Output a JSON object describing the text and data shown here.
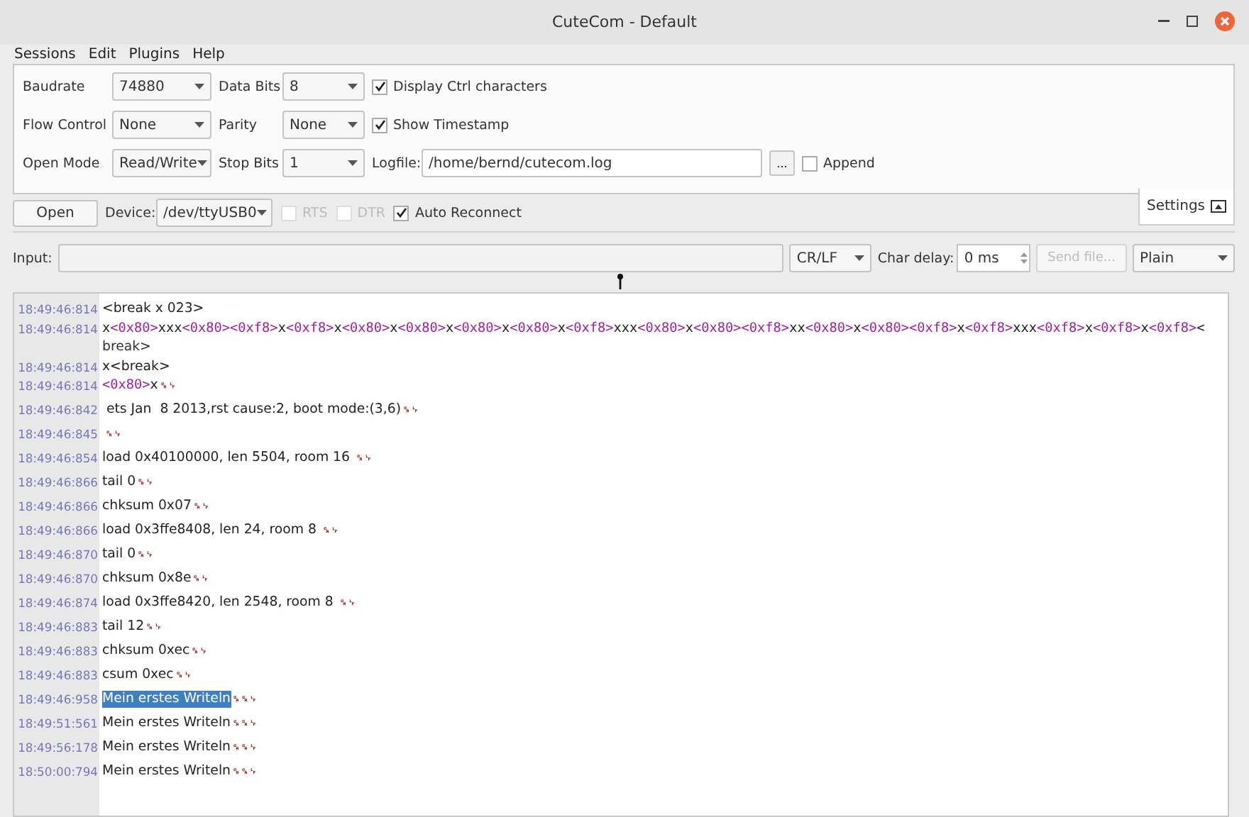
{
  "window": {
    "title": "CuteCom - Default"
  },
  "menu": [
    {
      "label": "Sessions"
    },
    {
      "label": "Edit"
    },
    {
      "label": "Plugins"
    },
    {
      "label": "Help"
    }
  ],
  "settings": {
    "rows": [
      {
        "label": "Baudrate",
        "combo_value": "74880",
        "label2": "Data Bits",
        "combo2_value": "8",
        "option": {
          "kind": "checkbox",
          "label": "Display Ctrl characters",
          "checked": true
        }
      },
      {
        "label": "Flow Control",
        "combo_value": "None",
        "label2": "Parity",
        "combo2_value": "None",
        "option": {
          "kind": "checkbox",
          "label": "Show Timestamp",
          "checked": true
        }
      },
      {
        "label": "Open Mode",
        "combo_value": "Read/Write",
        "label2": "Stop Bits",
        "combo2_value": "1",
        "option": {
          "kind": "logfile",
          "label": "Logfile:",
          "value": "/home/bernd/cutecom.log",
          "browse": "...",
          "append_label": "Append",
          "checked": false
        }
      }
    ],
    "tab_label": "Settings"
  },
  "device_bar": {
    "open_button": "Open",
    "device_label": "Device:",
    "device_value": "/dev/ttyUSB0",
    "checks": [
      {
        "label": "RTS",
        "checked": false,
        "disabled": true
      },
      {
        "label": "DTR",
        "checked": false,
        "disabled": true
      },
      {
        "label": "Auto Reconnect",
        "checked": true,
        "disabled": false
      }
    ]
  },
  "input_bar": {
    "label": "Input:",
    "line_end": "CR/LF",
    "char_delay_label": "Char delay:",
    "char_delay_value": "0 ms",
    "send_file": "Send file...",
    "send_file_disabled": true,
    "format": "Plain"
  },
  "log": [
    {
      "time": "18:49:46:814",
      "segments": [
        {
          "kind": "plain",
          "text": "<break x 023>"
        }
      ],
      "selected": false
    },
    {
      "time": "18:49:46:814",
      "segments": [
        {
          "kind": "plain",
          "text": "x"
        },
        {
          "kind": "hex",
          "text": "<0x80>"
        },
        {
          "kind": "plain",
          "text": "xxx"
        },
        {
          "kind": "hex",
          "text": "<0x80><0xf8>"
        },
        {
          "kind": "plain",
          "text": "x"
        },
        {
          "kind": "hex",
          "text": "<0xf8>"
        },
        {
          "kind": "plain",
          "text": "x"
        },
        {
          "kind": "hex",
          "text": "<0x80>"
        },
        {
          "kind": "plain",
          "text": "x"
        },
        {
          "kind": "hex",
          "text": "<0x80>"
        },
        {
          "kind": "plain",
          "text": "x"
        },
        {
          "kind": "hex",
          "text": "<0x80>"
        },
        {
          "kind": "plain",
          "text": "x"
        },
        {
          "kind": "hex",
          "text": "<0x80>"
        },
        {
          "kind": "plain",
          "text": "x"
        },
        {
          "kind": "hex",
          "text": "<0xf8>"
        },
        {
          "kind": "plain",
          "text": "xxx"
        },
        {
          "kind": "hex",
          "text": "<0x80>"
        },
        {
          "kind": "plain",
          "text": "x"
        },
        {
          "kind": "hex",
          "text": "<0x80><0xf8>"
        },
        {
          "kind": "plain",
          "text": "xx"
        },
        {
          "kind": "hex",
          "text": "<0x80>"
        },
        {
          "kind": "plain",
          "text": "x"
        },
        {
          "kind": "hex",
          "text": "<0x80><0xf8>"
        },
        {
          "kind": "plain",
          "text": "x"
        },
        {
          "kind": "hex",
          "text": "<0xf8>"
        },
        {
          "kind": "plain",
          "text": "xxx"
        },
        {
          "kind": "hex",
          "text": "<0xf8>"
        },
        {
          "kind": "plain",
          "text": "x"
        },
        {
          "kind": "hex",
          "text": "<0xf8>"
        },
        {
          "kind": "plain",
          "text": "x"
        },
        {
          "kind": "hex",
          "text": "<0xf8>"
        },
        {
          "kind": "plain",
          "text": "<"
        }
      ],
      "continuation": "break>",
      "selected": false
    },
    {
      "time": "18:49:46:814",
      "segments": [
        {
          "kind": "plain",
          "text": "x<break>"
        }
      ],
      "selected": false
    },
    {
      "time": "18:49:46:814",
      "segments": [
        {
          "kind": "hex",
          "text": "<0x80>"
        },
        {
          "kind": "plain",
          "text": "x"
        }
      ],
      "ctrl": "␍␊",
      "selected": false
    },
    {
      "time": "18:49:46:842",
      "segments": [
        {
          "kind": "plain",
          "text": " ets Jan  8 2013,rst cause:2, boot mode:(3,6)"
        }
      ],
      "ctrl": "␍␊",
      "selected": false
    },
    {
      "time": "18:49:46:845",
      "ctrl": "␍␊",
      "selected": false
    },
    {
      "time": "18:49:46:854",
      "segments": [
        {
          "kind": "plain",
          "text": "load 0x40100000, len 5504, room 16 "
        }
      ],
      "ctrl": "␍␊",
      "selected": false
    },
    {
      "time": "18:49:46:866",
      "segments": [
        {
          "kind": "plain",
          "text": "tail 0"
        }
      ],
      "ctrl": "␍␊",
      "selected": false
    },
    {
      "time": "18:49:46:866",
      "segments": [
        {
          "kind": "plain",
          "text": "chksum 0x07"
        }
      ],
      "ctrl": "␍␊",
      "selected": false
    },
    {
      "time": "18:49:46:866",
      "segments": [
        {
          "kind": "plain",
          "text": "load 0x3ffe8408, len 24, room 8 "
        }
      ],
      "ctrl": "␍␊",
      "selected": false
    },
    {
      "time": "18:49:46:870",
      "segments": [
        {
          "kind": "plain",
          "text": "tail 0"
        }
      ],
      "ctrl": "␍␊",
      "selected": false
    },
    {
      "time": "18:49:46:870",
      "segments": [
        {
          "kind": "plain",
          "text": "chksum 0x8e"
        }
      ],
      "ctrl": "␍␊",
      "selected": false
    },
    {
      "time": "18:49:46:874",
      "segments": [
        {
          "kind": "plain",
          "text": "load 0x3ffe8420, len 2548, room 8 "
        }
      ],
      "ctrl": "␍␊",
      "selected": false
    },
    {
      "time": "18:49:46:883",
      "segments": [
        {
          "kind": "plain",
          "text": "tail 12"
        }
      ],
      "ctrl": "␍␊",
      "selected": false
    },
    {
      "time": "18:49:46:883",
      "segments": [
        {
          "kind": "plain",
          "text": "chksum 0xec"
        }
      ],
      "ctrl": "␍␊",
      "selected": false
    },
    {
      "time": "18:49:46:883",
      "segments": [
        {
          "kind": "plain",
          "text": "csum 0xec"
        }
      ],
      "ctrl": "␍␊",
      "selected": false
    },
    {
      "time": "18:49:46:958",
      "segments": [
        {
          "kind": "plain",
          "text": "Mein erstes Writeln"
        }
      ],
      "ctrl": "␍␍␊",
      "selected": true
    },
    {
      "time": "18:49:51:561",
      "segments": [
        {
          "kind": "plain",
          "text": "Mein erstes Writeln"
        }
      ],
      "ctrl": "␍␍␊",
      "selected": false
    },
    {
      "time": "18:49:56:178",
      "segments": [
        {
          "kind": "plain",
          "text": "Mein erstes Writeln"
        }
      ],
      "ctrl": "␍␍␊",
      "selected": false
    },
    {
      "time": "18:50:00:794",
      "segments": [
        {
          "kind": "plain",
          "text": "Mein erstes Writeln"
        }
      ],
      "ctrl": "␍␍␊",
      "selected": false
    }
  ]
}
